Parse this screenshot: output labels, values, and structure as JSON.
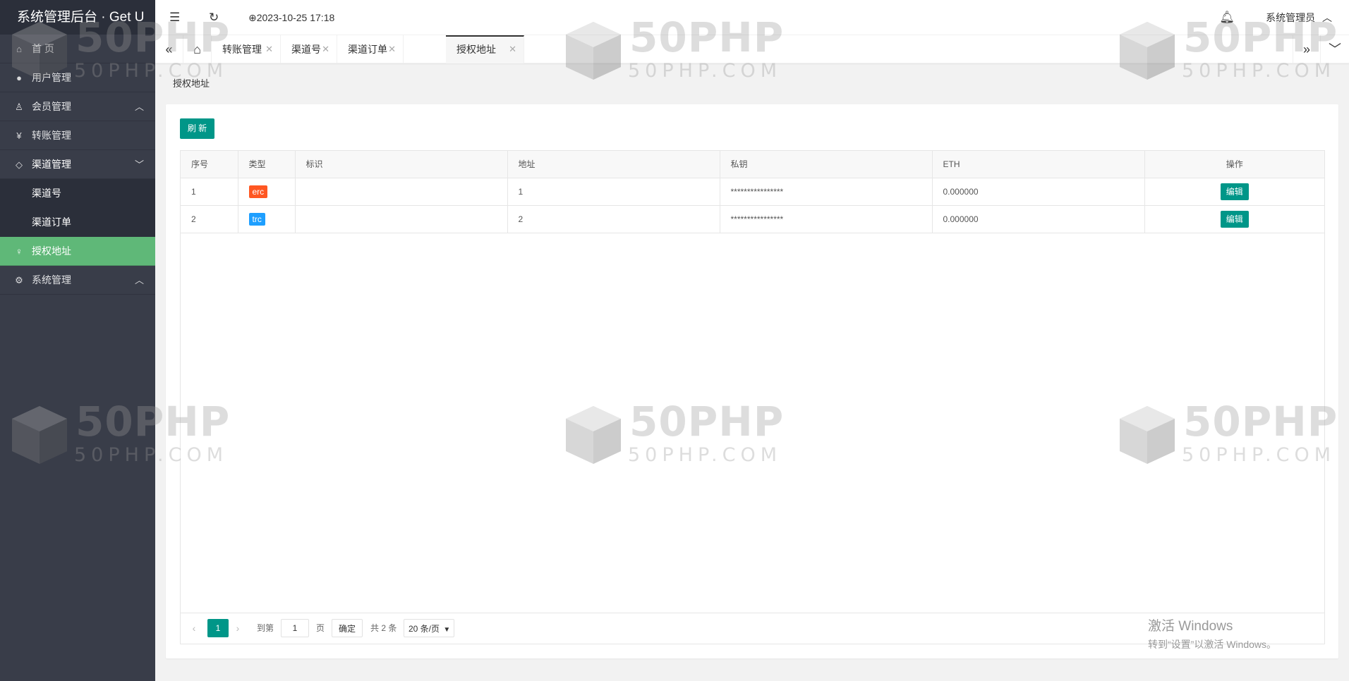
{
  "app": {
    "title": "系统管理后台 · Get U"
  },
  "sidebar": {
    "items": [
      {
        "label": "首 页",
        "icon": "home-icon"
      },
      {
        "label": "用户管理",
        "icon": "user-icon"
      },
      {
        "label": "会员管理",
        "icon": "member-icon",
        "expand": "collapsed"
      },
      {
        "label": "转账管理",
        "icon": "yen-icon"
      },
      {
        "label": "渠道管理",
        "icon": "tag-icon",
        "expand": "expanded",
        "children": [
          {
            "label": "渠道号"
          },
          {
            "label": "渠道订单"
          }
        ]
      },
      {
        "label": "授权地址",
        "icon": "pin-icon",
        "active": true
      },
      {
        "label": "系统管理",
        "icon": "gear-icon",
        "expand": "collapsed"
      }
    ]
  },
  "header": {
    "datetime": "2023-10-25 17:18",
    "user": "系统管理员"
  },
  "tabs": [
    {
      "label": "转账管理"
    },
    {
      "label": "渠道号"
    },
    {
      "label": "渠道订单"
    },
    {
      "label": "授权地址",
      "active": true
    }
  ],
  "breadcrumb": "授权地址",
  "toolbar": {
    "refresh_label": "刷 新"
  },
  "table": {
    "columns": [
      "序号",
      "类型",
      "标识",
      "地址",
      "私钥",
      "ETH",
      "操作"
    ],
    "rows": [
      {
        "no": "1",
        "type": "erc",
        "tag": "",
        "address": "1",
        "private_key": "****************",
        "eth": "0.000000",
        "action": "编辑"
      },
      {
        "no": "2",
        "type": "trc",
        "tag": "",
        "address": "2",
        "private_key": "****************",
        "eth": "0.000000",
        "action": "编辑"
      }
    ]
  },
  "pagination": {
    "current_page": "1",
    "goto_label": "到第",
    "page_input": "1",
    "page_suffix": "页",
    "confirm_label": "确定",
    "total": "共 2 条",
    "page_size": "20 条/页"
  },
  "watermark": {
    "big": "50PHP",
    "small": "50PHP.COM"
  },
  "activation": {
    "title": "激活 Windows",
    "subtitle": "转到“设置”以激活 Windows。"
  },
  "colors": {
    "sidebar": "#393d49",
    "sidebar_active": "#5fb878",
    "primary": "#009688",
    "erc": "#ff5722",
    "trc": "#1e9fff"
  }
}
